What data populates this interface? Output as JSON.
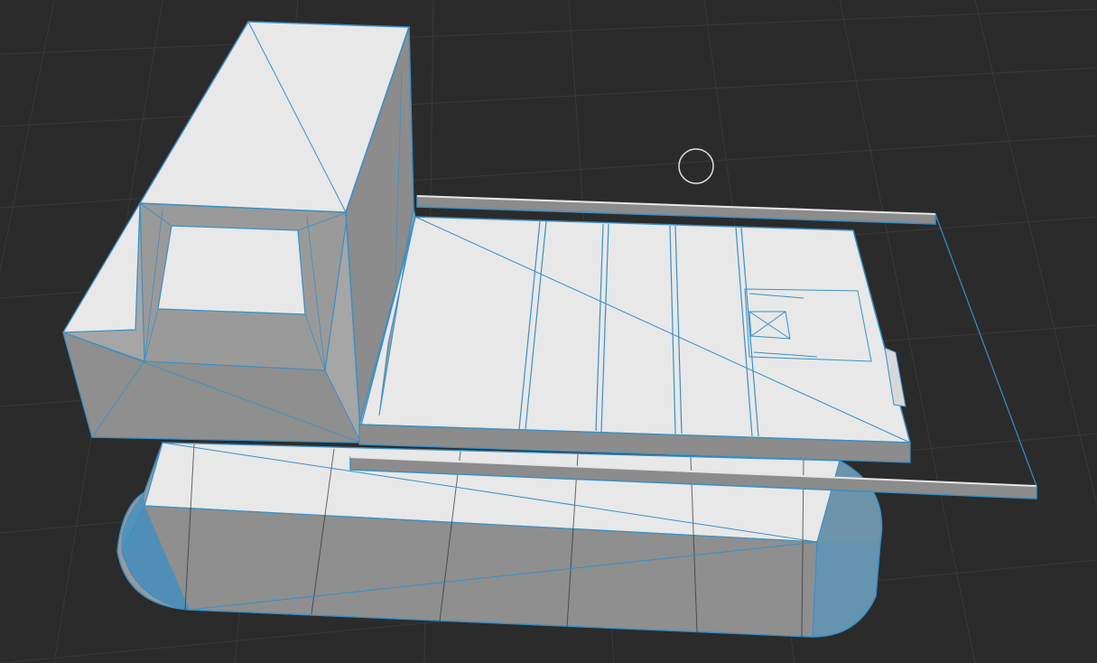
{
  "viewport": {
    "background_color": "#2b2b2b",
    "grid_color": "#3a3a3a",
    "wire_color": "#3a8fc4",
    "face_light": "#e6e6e6",
    "face_mid": "#a9a9a9",
    "face_dark": "#8c8c8c",
    "cursor_icon": "circle-cursor-icon"
  }
}
